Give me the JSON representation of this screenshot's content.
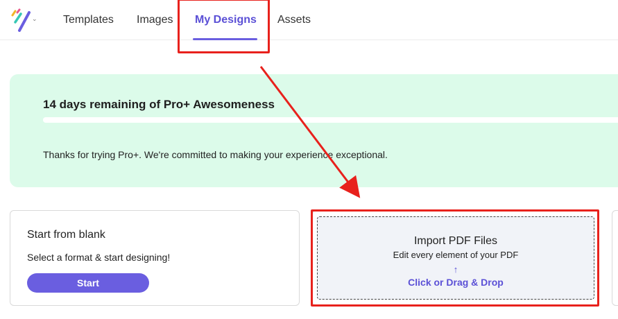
{
  "nav": {
    "items": [
      {
        "label": "Templates"
      },
      {
        "label": "Images"
      },
      {
        "label": "My Designs",
        "active": true
      },
      {
        "label": "Assets"
      }
    ]
  },
  "banner": {
    "title": "14 days remaining of Pro+ Awesomeness",
    "message": "Thanks for trying Pro+. We're committed to making your experience exceptional."
  },
  "cards": {
    "blank": {
      "title": "Start from blank",
      "subtitle": "Select a format & start designing!",
      "button_label": "Start"
    },
    "import": {
      "title": "Import PDF Files",
      "subtitle": "Edit every element of your PDF",
      "arrow": "↑",
      "cta": "Click or Drag & Drop"
    }
  },
  "colors": {
    "accent": "#6a5ee0",
    "banner_bg": "#dcfbea",
    "annotation": "#e8211c"
  }
}
